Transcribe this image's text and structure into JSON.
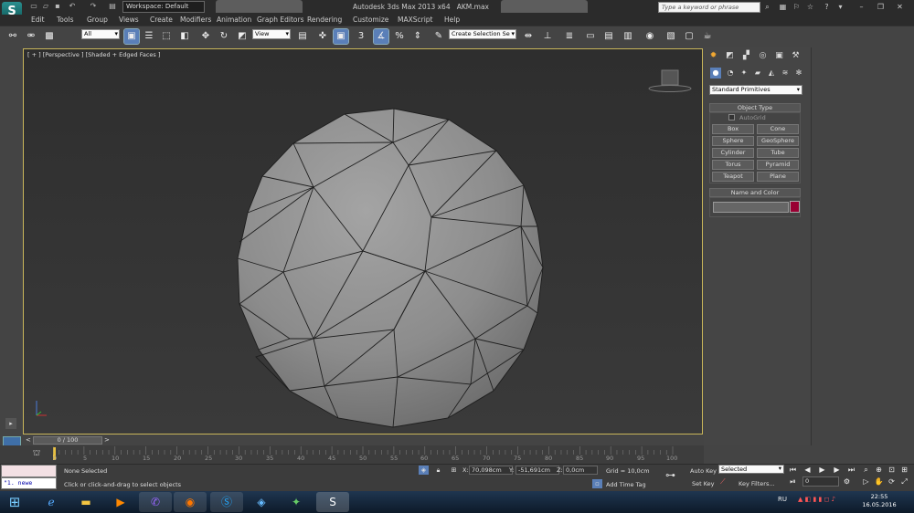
{
  "app": {
    "title": "Autodesk 3ds Max  2013 x64",
    "file": "AKM.max",
    "logo": "S"
  },
  "workspace": "Workspace: Default",
  "search": {
    "placeholder": "Type a keyword or phrase"
  },
  "menus": [
    "Edit",
    "Tools",
    "Group",
    "Views",
    "Create",
    "Modifiers",
    "Animation",
    "Graph Editors",
    "Rendering",
    "Customize",
    "MAXScript",
    "Help"
  ],
  "toolbar": {
    "selection_filter": "All",
    "ref_coord": "View",
    "snap_3": "3",
    "named_selection": "Create Selection Se"
  },
  "viewport": {
    "label": "[ + ] [Perspective ] [Shaded + Edged Faces ]"
  },
  "command_panel": {
    "category": "Standard Primitives",
    "object_type": {
      "header": "Object Type",
      "autogrid": "AutoGrid",
      "buttons": [
        "Box",
        "Cone",
        "Sphere",
        "GeoSphere",
        "Cylinder",
        "Tube",
        "Torus",
        "Pyramid",
        "Teapot",
        "Plane"
      ]
    },
    "name_color": {
      "header": "Name and Color",
      "color": "#990033"
    }
  },
  "timeline": {
    "slider": "0 / 100",
    "ticks": [
      "0",
      "5",
      "10",
      "15",
      "20",
      "25",
      "30",
      "35",
      "40",
      "45",
      "50",
      "55",
      "60",
      "65",
      "70",
      "75",
      "80",
      "85",
      "90",
      "95",
      "100"
    ]
  },
  "status": {
    "maxscript_line": "\"1.  newe",
    "selection": "None Selected",
    "prompt": "Click or click-and-drag to select objects",
    "x": "70,098cm",
    "y": "-51,691cm",
    "z": "0,0cm",
    "grid": "Grid = 10,0cm",
    "add_time_tag": "Add Time Tag",
    "auto_key": "Auto Key",
    "set_key": "Set Key",
    "key_mode": "Selected",
    "key_filters": "Key Filters...",
    "frame": "0"
  },
  "tray": {
    "lang": "RU",
    "time": "22:55",
    "date": "16.05.2016"
  }
}
